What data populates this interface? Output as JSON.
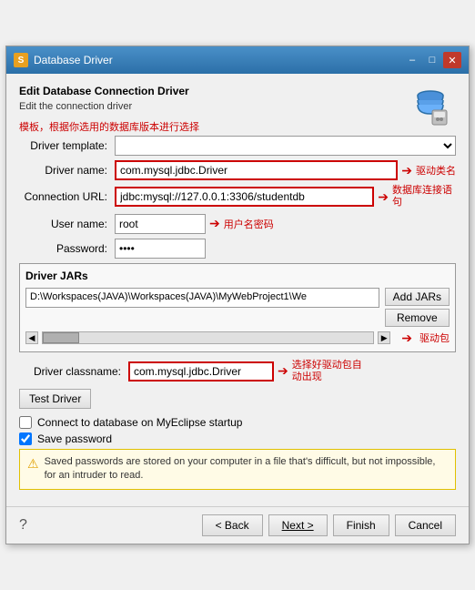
{
  "window": {
    "title": "Database Driver",
    "icon": "S"
  },
  "header": {
    "title": "Edit Database Connection Driver",
    "subtitle": "Edit the connection driver"
  },
  "annotations": {
    "template_note": "模板，根据你选用的数据库版本进行选择",
    "driver_name_note": "驱动类名",
    "connection_url_note": "数据库连接语句",
    "user_password_note": "用户名密码",
    "driver_jar_note": "驱动包",
    "classname_note": "选择好驱动包自动出现"
  },
  "form": {
    "driver_template_label": "Driver template:",
    "driver_template_value": "",
    "driver_name_label": "Driver name:",
    "driver_name_value": "com.mysql.jdbc.Driver",
    "connection_url_label": "Connection URL:",
    "connection_url_value": "jdbc:mysql://127.0.0.1:3306/studentdb",
    "user_name_label": "User name:",
    "user_name_value": "root",
    "password_label": "Password:",
    "password_value": "****"
  },
  "driver_jars": {
    "header": "Driver JARs",
    "path": "D:\\Workspaces(JAVA)\\Workspaces(JAVA)\\MyWebProject1\\We",
    "add_btn": "Add JARs",
    "remove_btn": "Remove"
  },
  "driver_classname": {
    "label": "Driver classname:",
    "value": "com.mysql.jdbc.Driver"
  },
  "test_driver_btn": "Test Driver",
  "checkboxes": {
    "connect_on_startup_label": "Connect to database on MyEclipse startup",
    "connect_on_startup_checked": false,
    "save_password_label": "Save password",
    "save_password_checked": true
  },
  "warning": {
    "text": "Saved passwords are stored on your computer in a file that's difficult, but not impossible, for an intruder to read."
  },
  "footer": {
    "back_btn": "< Back",
    "next_btn": "Next >",
    "finish_btn": "Finish",
    "cancel_btn": "Cancel",
    "help_icon": "?"
  }
}
